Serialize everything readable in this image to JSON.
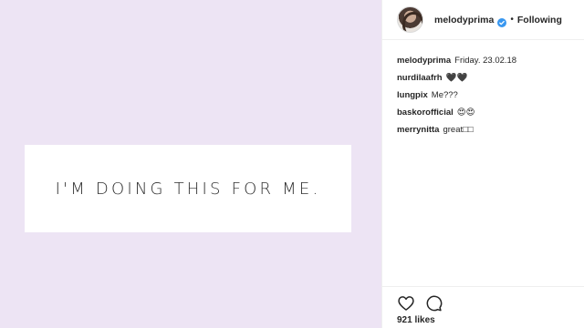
{
  "post": {
    "quote_text": "I'M DOING THIS FOR ME."
  },
  "header": {
    "username": "melodyprima",
    "separator": "•",
    "follow_label": "Following"
  },
  "caption": {
    "username": "melodyprima",
    "text": "Friday. 23.02.18"
  },
  "comments": [
    {
      "username": "nurdilaafrh",
      "text": "🖤🖤"
    },
    {
      "username": "lungpix",
      "text": "Me???"
    },
    {
      "username": "baskorofficial",
      "text": "😍😍"
    },
    {
      "username": "merrynitta",
      "text": "great□□"
    }
  ],
  "likes": {
    "label": "921 likes"
  },
  "icons": {
    "verified": "verified-badge-icon",
    "like": "heart-icon",
    "comment": "comment-bubble-icon"
  },
  "colors": {
    "post_background": "#ede4f4",
    "verified_blue": "#3897f0",
    "text_primary": "#262626",
    "text_secondary": "#8e8e8e"
  }
}
